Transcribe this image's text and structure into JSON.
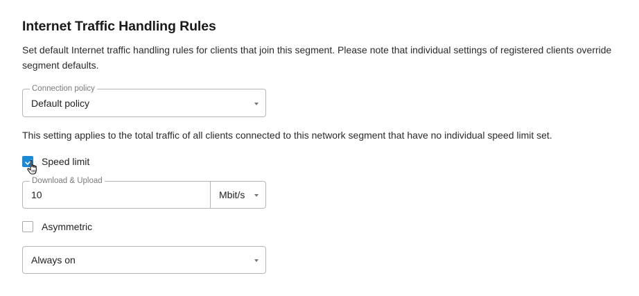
{
  "section": {
    "title": "Internet Traffic Handling Rules",
    "description": "Set default Internet traffic handling rules for clients that join this segment. Please note that individual settings of registered clients override segment defaults."
  },
  "connection_policy": {
    "legend": "Connection policy",
    "value": "Default policy"
  },
  "note": "This setting applies to the total traffic of all clients connected to this network segment that have no individual speed limit set.",
  "speed_limit": {
    "label": "Speed limit",
    "checked": true
  },
  "download_upload": {
    "legend": "Download & Upload",
    "value": "10",
    "unit": "Mbit/s"
  },
  "asymmetric": {
    "label": "Asymmetric",
    "checked": false
  },
  "schedule": {
    "value": "Always on"
  },
  "colors": {
    "accent": "#1a8ad6",
    "border": "#b5b5b5",
    "legend_text": "#7a7a7a"
  },
  "icons": {
    "caret": "chevron-down-icon",
    "check": "check-icon",
    "cursor": "hand-pointer-icon"
  }
}
